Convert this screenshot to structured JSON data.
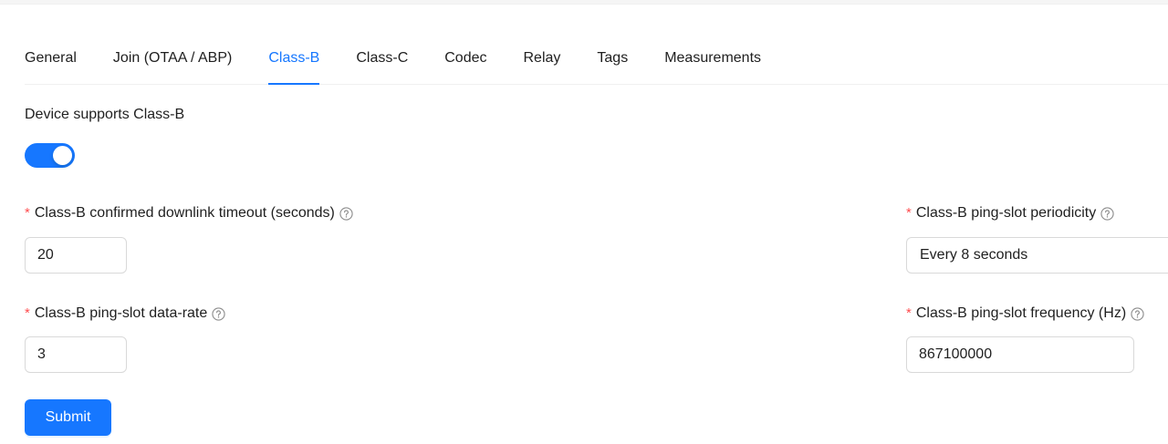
{
  "tabs": [
    {
      "label": "General"
    },
    {
      "label": "Join (OTAA / ABP)"
    },
    {
      "label": "Class-B"
    },
    {
      "label": "Class-C"
    },
    {
      "label": "Codec"
    },
    {
      "label": "Relay"
    },
    {
      "label": "Tags"
    },
    {
      "label": "Measurements"
    }
  ],
  "active_tab": "Class-B",
  "colors": {
    "primary": "#1677ff",
    "required": "#ff4d4f"
  },
  "form": {
    "supports_label": "Device supports Class-B",
    "supports_enabled": true,
    "required_mark": "*",
    "timeout": {
      "label": "Class-B confirmed downlink timeout (seconds)",
      "value": "20"
    },
    "periodicity": {
      "label": "Class-B ping-slot periodicity",
      "value": "Every 8 seconds"
    },
    "data_rate": {
      "label": "Class-B ping-slot data-rate",
      "value": "3"
    },
    "frequency": {
      "label": "Class-B ping-slot frequency (Hz)",
      "value": "867100000"
    },
    "submit_label": "Submit"
  },
  "icons": {
    "help": "question-circle-icon"
  }
}
